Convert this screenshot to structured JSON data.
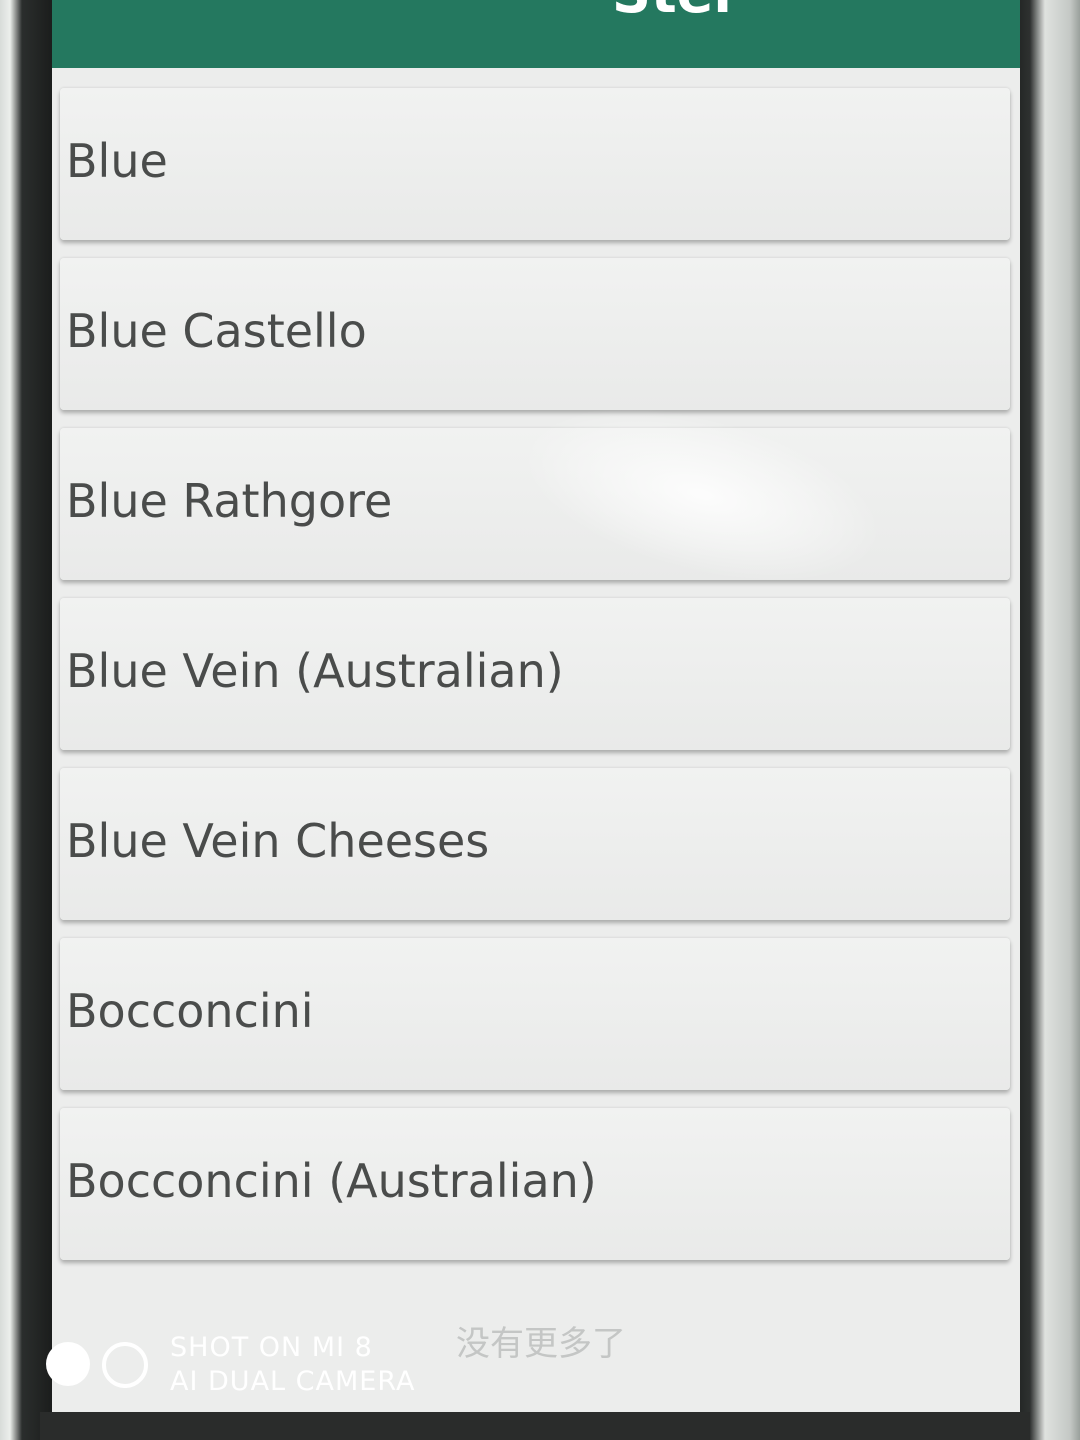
{
  "app_bar": {
    "title": "Ster",
    "color": "#24785f"
  },
  "list": {
    "items": [
      {
        "label": "Blue"
      },
      {
        "label": "Blue Castello"
      },
      {
        "label": "Blue Rathgore"
      },
      {
        "label": "Blue Vein (Australian)"
      },
      {
        "label": "Blue Vein Cheeses"
      },
      {
        "label": "Bocconcini"
      },
      {
        "label": "Bocconcini (Australian)"
      }
    ]
  },
  "footer": {
    "end_of_list_text": "没有更多了"
  },
  "camera_watermark": {
    "line1": "SHOT ON MI 8",
    "line2": "AI DUAL CAMERA"
  }
}
